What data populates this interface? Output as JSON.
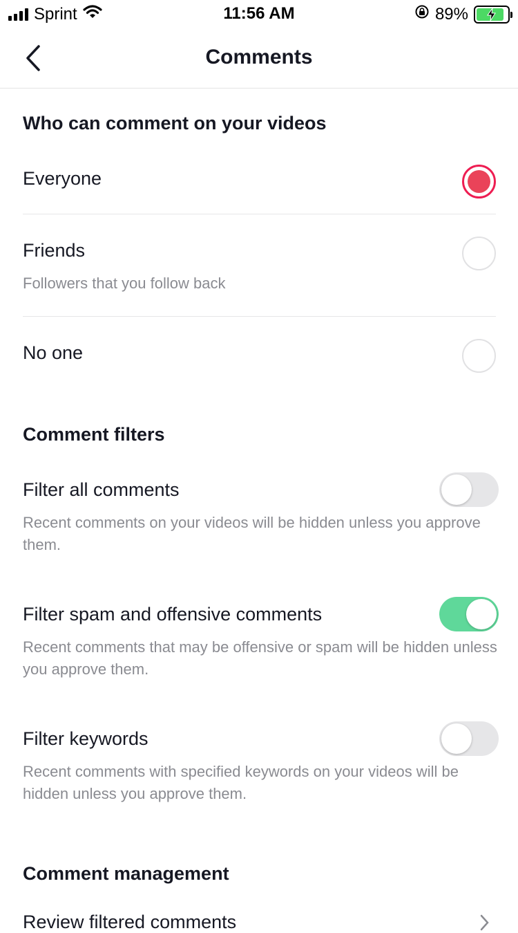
{
  "status_bar": {
    "carrier": "Sprint",
    "time": "11:56 AM",
    "battery_percent": "89%",
    "battery_level": 0.89,
    "battery_color": "#4cd964",
    "icons": [
      "signal-bars-icon",
      "wifi-icon",
      "rotation-lock-icon",
      "battery-charging-icon"
    ]
  },
  "nav": {
    "title": "Comments",
    "back_icon": "chevron-left-icon"
  },
  "who_can_comment": {
    "title": "Who can comment on your videos",
    "options": [
      {
        "label": "Everyone",
        "sub": "",
        "selected": true
      },
      {
        "label": "Friends",
        "sub": "Followers that you follow back",
        "selected": false
      },
      {
        "label": "No one",
        "sub": "",
        "selected": false
      }
    ],
    "accent_color": "#ee1d52"
  },
  "comment_filters": {
    "title": "Comment filters",
    "items": [
      {
        "label": "Filter all comments",
        "description": "Recent comments on your videos will be hidden unless you approve them.",
        "enabled": false
      },
      {
        "label": "Filter spam and offensive comments",
        "description": "Recent comments that may be offensive or spam will be hidden unless you approve them.",
        "enabled": true
      },
      {
        "label": "Filter keywords",
        "description": "Recent comments with specified keywords on your videos will be hidden unless you approve them.",
        "enabled": false
      }
    ],
    "toggle_on_color": "#5fd89a"
  },
  "comment_management": {
    "title": "Comment management",
    "items": [
      {
        "label": "Review filtered comments"
      }
    ]
  }
}
